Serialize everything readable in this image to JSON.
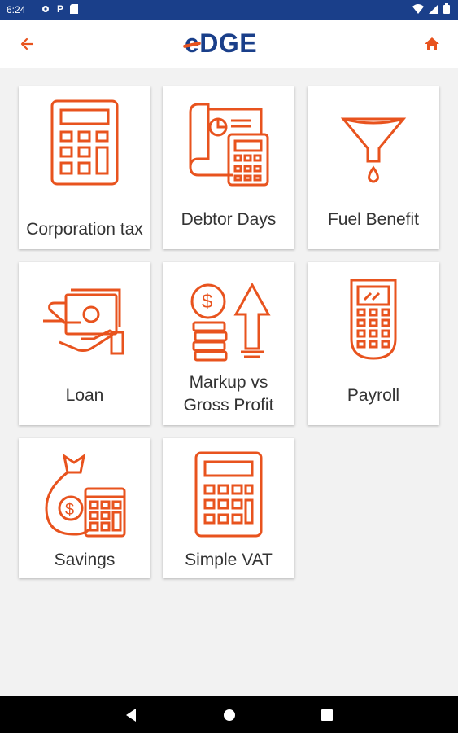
{
  "status_bar": {
    "time": "6:24",
    "p_label": "P"
  },
  "app": {
    "logo_text": "DGE",
    "logo_e": "e"
  },
  "tiles": [
    {
      "label": "Corporation tax",
      "icon": "calculator-icon"
    },
    {
      "label": "Debtor Days",
      "icon": "blueprint-calculator-icon"
    },
    {
      "label": "Fuel Benefit",
      "icon": "funnel-icon"
    },
    {
      "label": "Loan",
      "icon": "hand-money-icon"
    },
    {
      "label": "Markup vs Gross Profit",
      "icon": "coins-arrow-icon"
    },
    {
      "label": "Payroll",
      "icon": "pos-terminal-icon"
    },
    {
      "label": "Savings",
      "icon": "money-bag-calculator-icon"
    },
    {
      "label": "Simple VAT",
      "icon": "calculator-icon"
    }
  ],
  "colors": {
    "accent": "#e8531e",
    "brand_blue": "#1a3f8a",
    "background": "#f2f2f2"
  }
}
